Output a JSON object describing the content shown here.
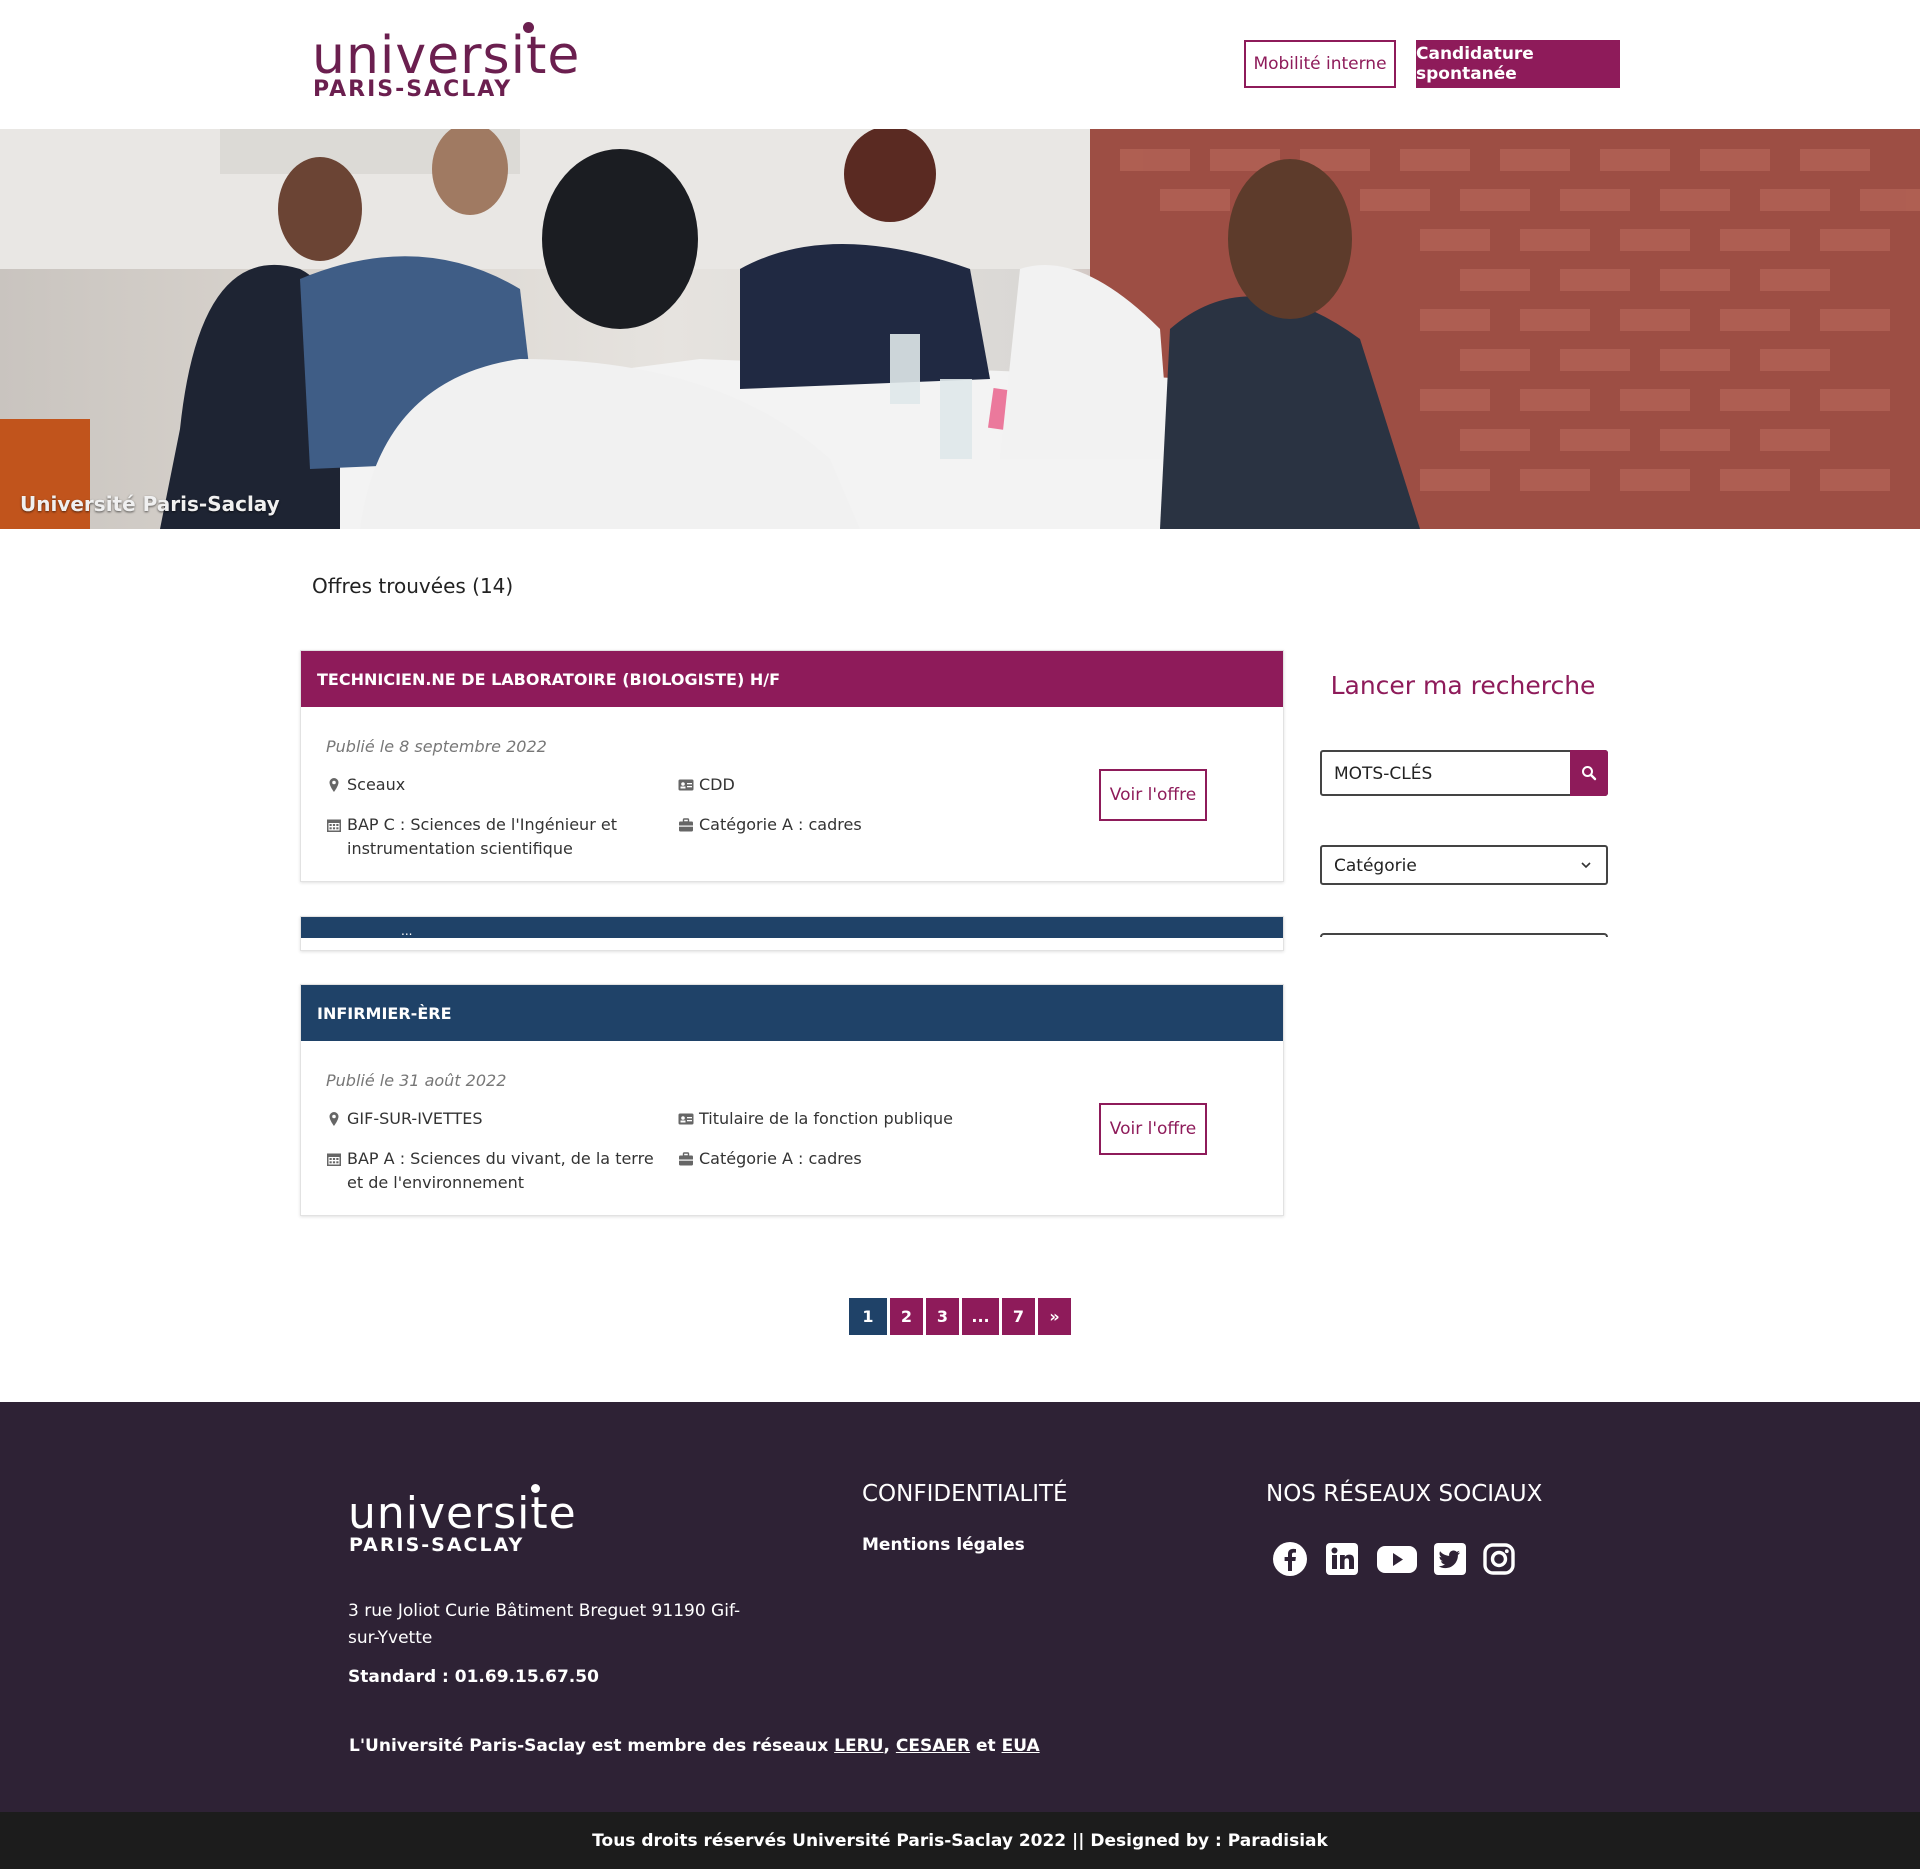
{
  "header": {
    "logo_word": "universite",
    "logo_sub": "PARIS-SACLAY",
    "btn_mobilite": "Mobilité interne",
    "btn_candidature": "Candidature spontanée"
  },
  "hero": {
    "caption": "Université Paris-Saclay"
  },
  "results": {
    "count_label": "Offres trouvées (14)",
    "offers": [
      {
        "title": "TECHNICIEN.NE DE LABORATOIRE (BIOLOGISTE) H/F",
        "published": "Publié le 8 septembre 2022",
        "location": "Sceaux",
        "contract": "CDD",
        "bap": "BAP C : Sciences de l'Ingénieur et instrumentation scientifique",
        "category": "Catégorie A : cadres",
        "button": "Voir l'offre",
        "header_color": "#8e1b5a"
      },
      {
        "title": "...",
        "header_color": "#1f4268"
      },
      {
        "title": "INFIRMIER-ÈRE",
        "published": "Publié le 31 août 2022",
        "location": "GIF-SUR-IVETTES",
        "contract": "Titulaire de la fonction publique",
        "bap": "BAP A : Sciences du vivant, de la terre et de l'environnement",
        "category": "Catégorie A : cadres",
        "button": "Voir l'offre",
        "header_color": "#1f4268"
      }
    ]
  },
  "sidebar": {
    "title": "Lancer ma recherche",
    "keywords_placeholder": "MOTS-CLÉS",
    "category_select": "Catégorie"
  },
  "pagination": {
    "pages": [
      "1",
      "2",
      "3",
      "...",
      "7",
      "»"
    ],
    "active": "1"
  },
  "footer": {
    "logo_word": "universite",
    "logo_sub": "PARIS-SACLAY",
    "address": "3 rue Joliot Curie Bâtiment Breguet 91190 Gif-sur-Yvette",
    "phone": "Standard : 01.69.15.67.50",
    "confidentiality_heading": "CONFIDENTIALITÉ",
    "mentions": "Mentions légales",
    "social_heading": "NOS RÉSEAUX SOCIAUX",
    "social_icons": [
      "facebook-icon",
      "linkedin-icon",
      "youtube-icon",
      "twitter-icon",
      "instagram-icon"
    ],
    "networks_prefix": "L'Université Paris-Saclay est membre des réseaux",
    "network_leru": "LERU",
    "network_comma": ",",
    "network_cesaer": "CESAER",
    "network_and": "et",
    "network_eua": "EUA",
    "copyright": "Tous droits réservés Université Paris-Saclay 2022 || Designed by : Paradisiak"
  },
  "colors": {
    "brand": "#8e1b5a",
    "navy": "#1f4268",
    "footer_bg": "#2e2235",
    "bottom_bg": "#1c1c1c"
  }
}
